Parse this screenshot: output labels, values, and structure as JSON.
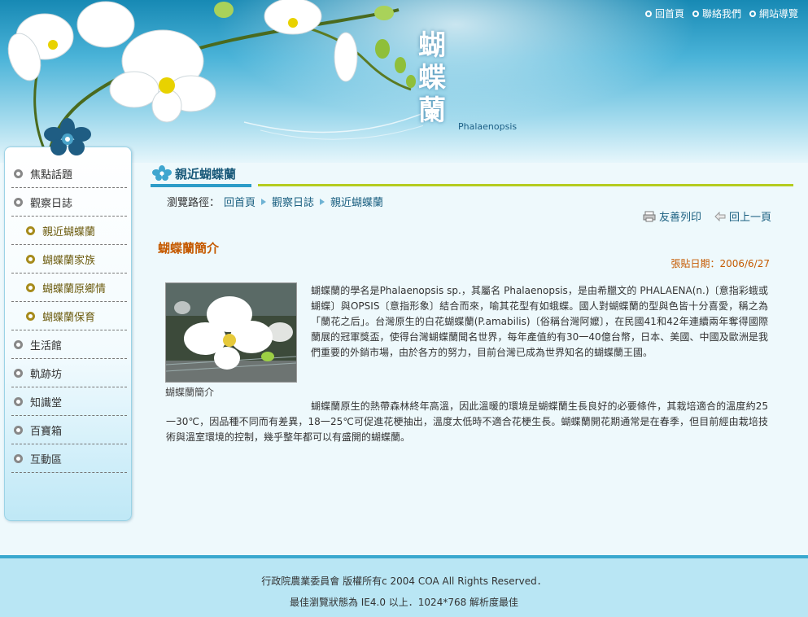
{
  "header": {
    "title_chars": [
      "蝴",
      "蝶",
      "蘭"
    ],
    "subtitle": "Phalaenopsis",
    "top_links": [
      {
        "label": "回首頁"
      },
      {
        "label": "聯絡我們"
      },
      {
        "label": "網站導覽"
      }
    ]
  },
  "sidebar": {
    "items": [
      {
        "label": "焦點話題",
        "sub": false
      },
      {
        "label": "觀察日誌",
        "sub": false
      },
      {
        "label": "親近蝴蝶蘭",
        "sub": true
      },
      {
        "label": "蝴蝶蘭家族",
        "sub": true
      },
      {
        "label": "蝴蝶蘭原鄉情",
        "sub": true
      },
      {
        "label": "蝴蝶蘭保育",
        "sub": true
      },
      {
        "label": "生活館",
        "sub": false
      },
      {
        "label": "軌跡坊",
        "sub": false
      },
      {
        "label": "知識堂",
        "sub": false
      },
      {
        "label": "百寶箱",
        "sub": false
      },
      {
        "label": "互動區",
        "sub": false
      }
    ]
  },
  "section": {
    "title": "親近蝴蝶蘭"
  },
  "breadcrumb": {
    "prefix": "瀏覽路徑：",
    "items": [
      "回首頁",
      "觀察日誌",
      "親近蝴蝶蘭"
    ]
  },
  "tools": {
    "print_label": "友善列印",
    "back_label": "回上一頁"
  },
  "article": {
    "title": "蝴蝶蘭簡介",
    "date": "張貼日期：2006/6/27",
    "caption": "蝴蝶蘭簡介",
    "paragraph1": "蝴蝶蘭的學名是Phalaenopsis sp.，其屬名 Phalaenopsis，是由希臘文的 PHALAENA(n.)〔意指彩蛾或蝴蝶〕與OPSIS〔意指形象〕結合而來，喻其花型有如蛾蝶。國人對蝴蝶蘭的型與色皆十分喜愛，稱之為「蘭花之后」。台灣原生的白花蝴蝶蘭(P.amabilis)〔俗稱台灣阿嬤〕，在民國41和42年連續兩年奪得國際蘭展的冠軍獎盃，使得台灣蝴蝶蘭聞名世界，每年產值約有30一40億台幣，日本、美國、中國及歐洲是我們重要的外銷市場，由於各方的努力，目前台灣已成為世界知名的蝴蝶蘭王國。",
    "paragraph2": "蝴蝶蘭原生的熱帶森林終年高溫，因此溫暖的環境是蝴蝶蘭生長良好的必要條件，其栽培適合的溫度約25一30℃，因品種不同而有差異，18一25℃可促進花梗抽出，溫度太低時不適合花梗生長。蝴蝶蘭開花期通常是在春季，但目前經由栽培技術與溫室環境的控制，幾乎整年都可以有盛開的蝴蝶蘭。"
  },
  "footer": {
    "line1": "行政院農業委員會 版權所有c 2004 COA All Rights Reserved．",
    "line2": "最佳瀏覽狀態為 IE4.0 以上．1024*768 解析度最佳"
  }
}
